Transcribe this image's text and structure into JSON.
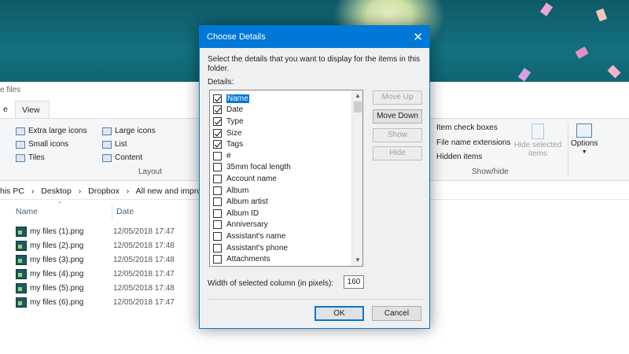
{
  "explorer": {
    "title_fragment": "e files",
    "tab_partial": "e",
    "view_tab": "View",
    "layout": {
      "items": [
        "Extra large icons",
        "Large icons",
        "Small icons",
        "List",
        "Tiles",
        "Content"
      ],
      "group_label": "Layout"
    },
    "show_hide": {
      "item_check_boxes": "Item check boxes",
      "file_name_extensions": "File name extensions",
      "hidden_items": "Hidden items",
      "hide_selected": "Hide selected items",
      "group_label": "Show/hide"
    },
    "options_label": "Options",
    "breadcrumb": [
      "his PC",
      "›",
      "Desktop",
      "›",
      "Dropbox",
      "›",
      "All new and improve"
    ],
    "columns": {
      "name": "Name",
      "date": "Date"
    },
    "files": [
      {
        "name": "my files (1).png",
        "date": "12/05/2018 17:47"
      },
      {
        "name": "my files (2).png",
        "date": "12/05/2018 17:48"
      },
      {
        "name": "my files (3).png",
        "date": "12/05/2018 17:48"
      },
      {
        "name": "my files (4).png",
        "date": "12/05/2018 17:47"
      },
      {
        "name": "my files (5).png",
        "date": "12/05/2018 17:48"
      },
      {
        "name": "my files (6).png",
        "date": "12/05/2018 17:47"
      }
    ]
  },
  "dialog": {
    "title": "Choose Details",
    "close_glyph": "✕",
    "instructions": "Select the details that you want to display for the items in this folder.",
    "details_label": "Details:",
    "details": [
      {
        "label": "Name",
        "checked": true,
        "selected": true
      },
      {
        "label": "Date",
        "checked": true
      },
      {
        "label": "Type",
        "checked": true
      },
      {
        "label": "Size",
        "checked": true
      },
      {
        "label": "Tags",
        "checked": true
      },
      {
        "label": "#",
        "checked": false
      },
      {
        "label": "35mm focal length",
        "checked": false
      },
      {
        "label": "Account name",
        "checked": false
      },
      {
        "label": "Album",
        "checked": false
      },
      {
        "label": "Album artist",
        "checked": false
      },
      {
        "label": "Album ID",
        "checked": false
      },
      {
        "label": "Anniversary",
        "checked": false
      },
      {
        "label": "Assistant's name",
        "checked": false
      },
      {
        "label": "Assistant's phone",
        "checked": false
      },
      {
        "label": "Attachments",
        "checked": false
      }
    ],
    "buttons": {
      "move_up": "Move Up",
      "move_down": "Move Down",
      "show": "Show",
      "hide": "Hide"
    },
    "width_label": "Width of selected column (in pixels):",
    "width_value": "160",
    "ok": "OK",
    "cancel": "Cancel"
  },
  "colors": {
    "accent": "#0078d7",
    "wallpaper": "#147080"
  }
}
